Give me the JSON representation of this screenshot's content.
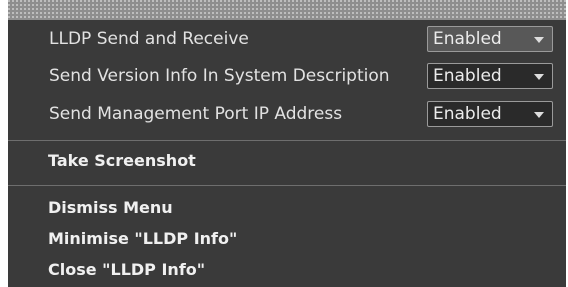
{
  "settings": [
    {
      "label": "LLDP Send and Receive",
      "value": "Enabled"
    },
    {
      "label": "Send Version Info In System Description",
      "value": "Enabled"
    },
    {
      "label": "Send Management Port IP Address",
      "value": "Enabled"
    }
  ],
  "actions": {
    "screenshot": "Take Screenshot",
    "dismiss": "Dismiss Menu",
    "minimise": "Minimise \"LLDP Info\"",
    "close": "Close \"LLDP Info\""
  },
  "icons": {
    "dropdown": "chevron-down-icon"
  }
}
